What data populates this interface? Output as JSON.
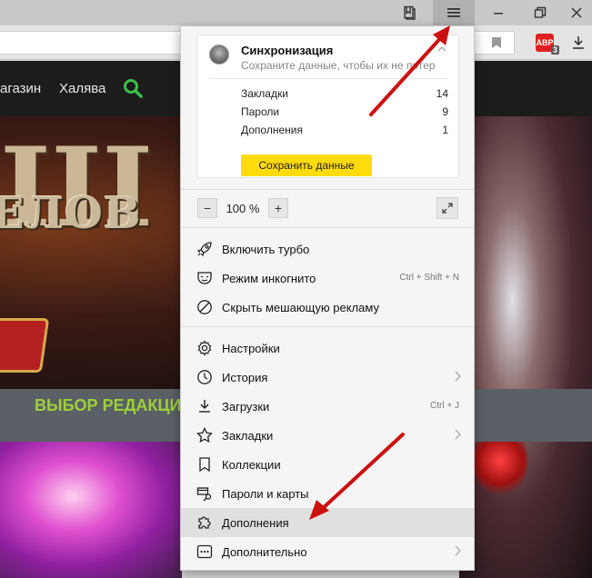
{
  "browser": {
    "titlebar_icons": [
      "bookmarks-manager-icon",
      "hamburger-menu-icon",
      "minimize-icon",
      "maximize-icon",
      "close-icon"
    ],
    "adblock_badge": "ABP",
    "adblock_count": "3"
  },
  "site": {
    "nav": {
      "shop": "агазин",
      "free": "Халява"
    },
    "logo_mark": "III",
    "logo_text": "ЕЛОВ",
    "editor_choice": "ВЫБОР РЕДАКЦИИ"
  },
  "menu": {
    "sync": {
      "title": "Синхронизация",
      "subtitle": "Сохраните данные, чтобы их не потер...",
      "rows": [
        {
          "label": "Закладки",
          "value": "14"
        },
        {
          "label": "Пароли",
          "value": "9"
        },
        {
          "label": "Дополнения",
          "value": "1"
        }
      ],
      "save_button": "Сохранить данные"
    },
    "zoom": {
      "minus": "−",
      "value": "100 %",
      "plus": "+"
    },
    "items": [
      {
        "label": "Включить турбо",
        "icon": "rocket-icon",
        "shortcut": "",
        "arrow": false
      },
      {
        "label": "Режим инкогнито",
        "icon": "incognito-mask-icon",
        "shortcut": "Ctrl + Shift + N",
        "arrow": false
      },
      {
        "label": "Скрыть мешающую рекламу",
        "icon": "block-ads-icon",
        "shortcut": "",
        "arrow": false
      },
      {
        "label": "Настройки",
        "icon": "gear-icon",
        "shortcut": "",
        "arrow": false
      },
      {
        "label": "История",
        "icon": "clock-icon",
        "shortcut": "",
        "arrow": true
      },
      {
        "label": "Загрузки",
        "icon": "download-icon",
        "shortcut": "Ctrl + J",
        "arrow": false
      },
      {
        "label": "Закладки",
        "icon": "star-icon",
        "shortcut": "",
        "arrow": true
      },
      {
        "label": "Коллекции",
        "icon": "collections-bookmark-icon",
        "shortcut": "",
        "arrow": false
      },
      {
        "label": "Пароли и карты",
        "icon": "key-card-icon",
        "shortcut": "",
        "arrow": false
      },
      {
        "label": "Дополнения",
        "icon": "puzzle-icon",
        "shortcut": "",
        "arrow": false
      },
      {
        "label": "Дополнительно",
        "icon": "more-dots-icon",
        "shortcut": "",
        "arrow": true
      }
    ],
    "colors": {
      "save_button": "#ffdb0a",
      "active_item": "#e0e0e0",
      "arrow_annotation": "#d01010"
    }
  }
}
